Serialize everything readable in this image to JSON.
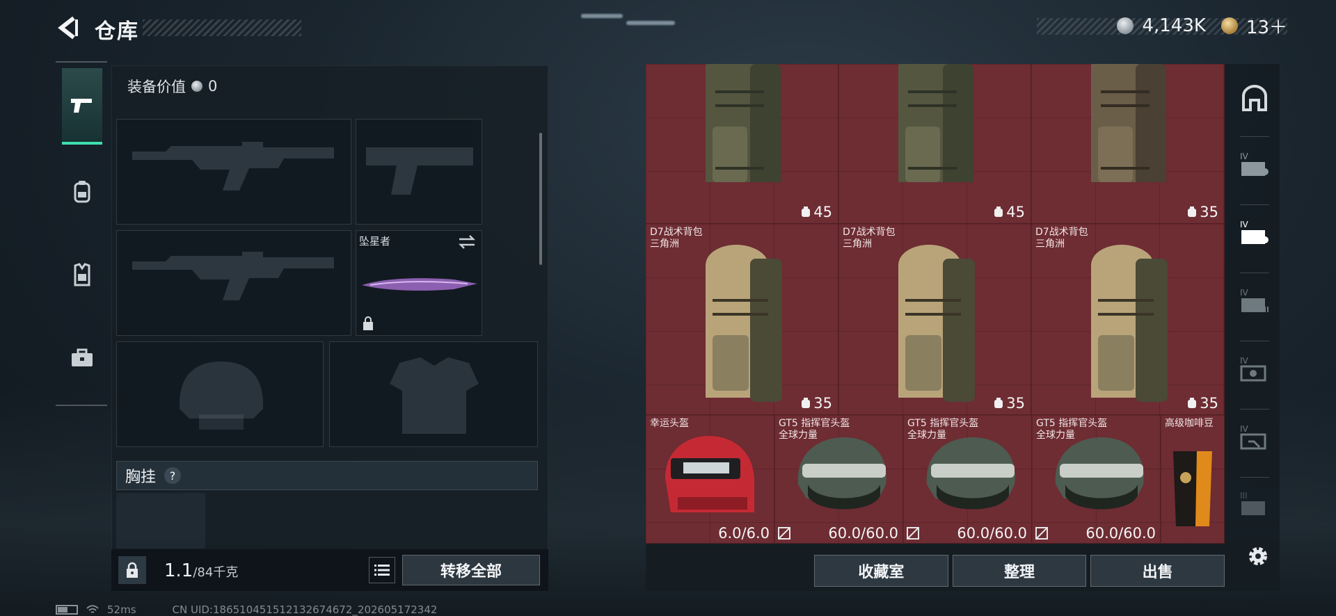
{
  "header": {
    "title": "仓库",
    "currency_silver": "4,143K",
    "currency_gold": "13＋"
  },
  "left_tabs": [
    {
      "icon": "pistol-icon",
      "active": true
    },
    {
      "icon": "backpack-icon",
      "active": false
    },
    {
      "icon": "vest-icon",
      "active": false
    },
    {
      "icon": "briefcase-icon",
      "active": false
    }
  ],
  "loadout": {
    "equip_value_label": "装备价值",
    "equip_value": "0",
    "melee_name": "坠星者",
    "chest_label": "胸挂",
    "chest_help": "?",
    "weight_value": "1.1",
    "weight_unit": "/84千克",
    "move_all_label": "转移全部"
  },
  "grid": {
    "backpack_top": [
      {
        "capacity": "45"
      },
      {
        "capacity": "45"
      },
      {
        "capacity": "35"
      }
    ],
    "backpack_mid": [
      {
        "name": "D7战术背包",
        "sub": "三角洲",
        "capacity": "35"
      },
      {
        "name": "D7战术背包",
        "sub": "三角洲",
        "capacity": "35"
      },
      {
        "name": "D7战术背包",
        "sub": "三角洲",
        "capacity": "35"
      }
    ],
    "bottom": [
      {
        "name": "幸运头盔",
        "sub": "",
        "durability": "6.0/6.0"
      },
      {
        "name": "GT5 指挥官头盔",
        "sub": "全球力量",
        "durability": "60.0/60.0"
      },
      {
        "name": "GT5 指挥官头盔",
        "sub": "全球力量",
        "durability": "60.0/60.0"
      },
      {
        "name": "GT5 指挥官头盔",
        "sub": "全球力量",
        "durability": "60.0/60.0"
      },
      {
        "name": "高级咖啡豆",
        "sub": "",
        "durability": ""
      }
    ]
  },
  "actions": {
    "collection_label": "收藏室",
    "sort_label": "整理",
    "sell_label": "出售"
  },
  "right_sidebar": [
    {
      "icon": "safehouse-icon",
      "tier": ""
    },
    {
      "icon": "storage-expansion-icon",
      "tier": "IV"
    },
    {
      "icon": "storage-expansion-icon",
      "tier": "IV"
    },
    {
      "icon": "storage-expansion-icon",
      "tier": "IV"
    },
    {
      "icon": "storage-expansion-icon",
      "tier": "IV"
    },
    {
      "icon": "storage-expansion-icon",
      "tier": "IV"
    },
    {
      "icon": "storage-expansion-icon",
      "tier": "III"
    }
  ],
  "status": {
    "ping": "52ms",
    "uid": "CN UID:18651045151213267467​2_202605172342"
  },
  "colors": {
    "accent": "#3ee0b0",
    "grid_bg": "#6e2c33",
    "panel_bg": "#161e25"
  }
}
